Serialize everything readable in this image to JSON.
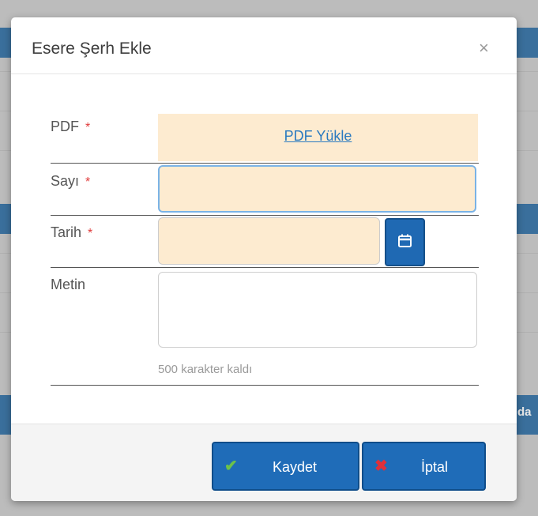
{
  "modal": {
    "title": "Esere Şerh Ekle",
    "close_glyph": "×"
  },
  "form": {
    "pdf_label": "PDF",
    "pdf_link": "PDF Yükle",
    "sayi_label": "Sayı",
    "sayi_value": "",
    "tarih_label": "Tarih",
    "tarih_value": "",
    "metin_label": "Metin",
    "metin_value": "",
    "required_mark": "*",
    "char_hint": "500 karakter kaldı"
  },
  "footer": {
    "save_label": "Kaydet",
    "save_icon": "✔",
    "cancel_label": "İptal",
    "cancel_icon": "✖"
  },
  "background": {
    "fragment_text": "da"
  },
  "colors": {
    "accent": "#1f6cb8",
    "required": "#e03b3b",
    "field_fill": "#fdebd0",
    "link": "#2a7ac0",
    "save_icon": "#6cc24a",
    "cancel_icon": "#e0303a"
  }
}
